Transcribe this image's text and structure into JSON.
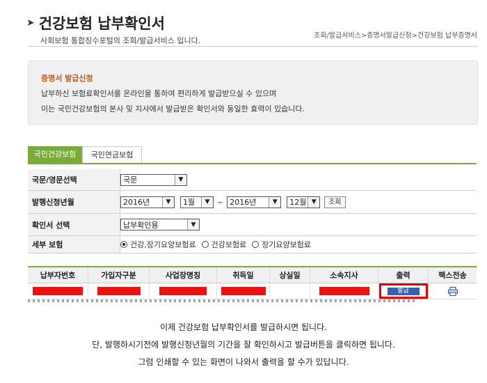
{
  "header": {
    "title": "건강보험 납부확인서",
    "subtitle": "사회보험 통합징수포털의 조회/발급서비스 입니다.",
    "breadcrumb": "조회/발급서비스>증명서발급신청>건강보험 납부증명서"
  },
  "info": {
    "title": "증명서 발급신청",
    "line1": "납부하신 보험료확인서를 온라인을 통하여 편리하게 발급받으실 수 있으며",
    "line2": "이는 국민건강보험의 본사 및 지사에서 발급받은 확인서와 동일한 효력이 있습니다."
  },
  "tabs": [
    "국민건강보험",
    "국민연금보험"
  ],
  "form": {
    "language": {
      "label": "국문/영문선택",
      "value": "국문"
    },
    "period": {
      "label": "발행신청년월",
      "from_year": "2016년",
      "from_month": "1월",
      "tilde": "~",
      "to_year": "2016년",
      "to_month": "12월",
      "button": "조회"
    },
    "cert_type": {
      "label": "확인서 선택",
      "value": "납부확인용"
    },
    "insurance": {
      "label": "세부 보험",
      "options": [
        "건강,장기요양보험료",
        "건강보험료",
        "장기요양보험료"
      ],
      "selected_index": 0
    }
  },
  "grid": {
    "headers": [
      "납부자번호",
      "가입자구분",
      "사업장명칭",
      "취득일",
      "상실일",
      "소속지사",
      "출력",
      "팩스전송"
    ],
    "issue_button": "발급"
  },
  "colors": {
    "accent_green": "#7aab3a",
    "redaction": "#ee1111",
    "highlight": "#e60000",
    "issue_button": "#2f62b8"
  },
  "caption": {
    "line1": "이제 건강보험 납부확인서를 발급하시면 됩니다.",
    "line2": "단, 발행하시기전에 발행신청년월의 기간을 잘 확인하시고 발급버튼을 클릭하면 됩니다.",
    "line3": "그럼 인쇄할 수 있는 화면이 나와서 출력을 할 수가 있답니다."
  }
}
